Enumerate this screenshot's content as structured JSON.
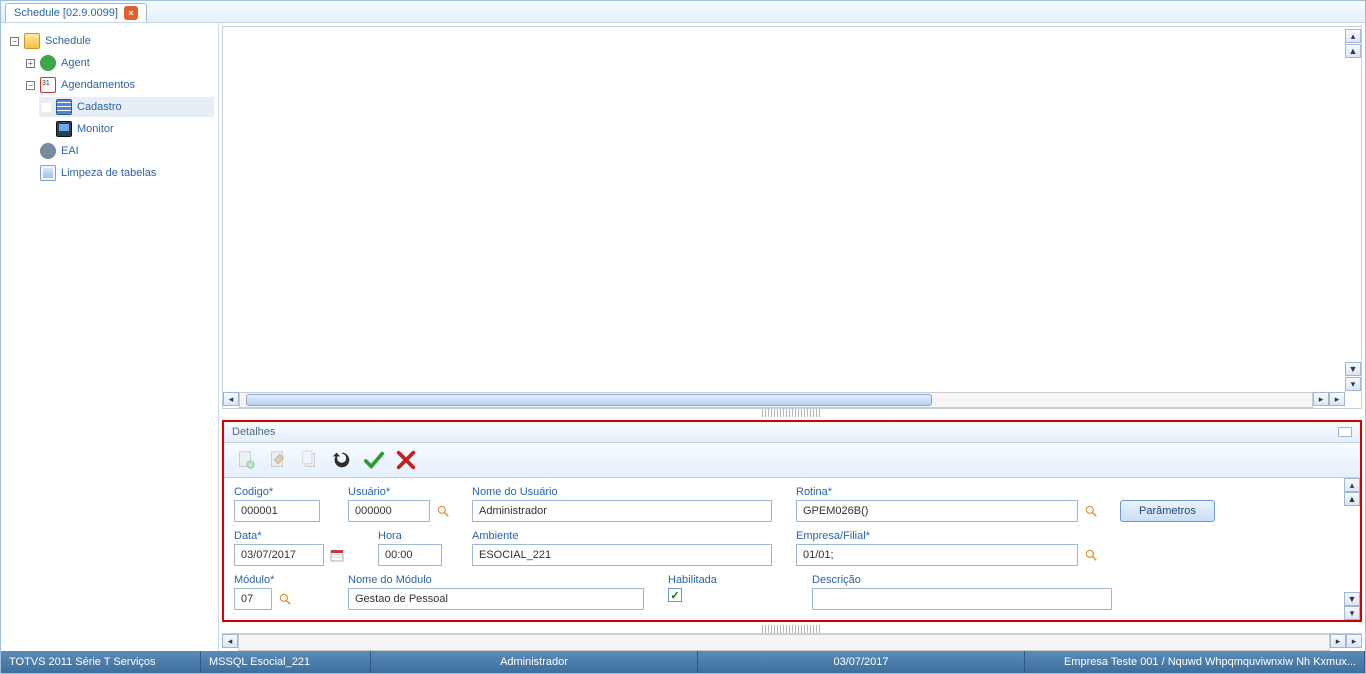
{
  "tab_title": "Schedule [02.9.0099]",
  "tree": {
    "root": "Schedule",
    "agent": "Agent",
    "agendamentos": "Agendamentos",
    "cadastro": "Cadastro",
    "monitor": "Monitor",
    "eai": "EAI",
    "limpeza": "Limpeza de tabelas"
  },
  "details": {
    "title": "Detalhes",
    "labels": {
      "codigo": "Codigo*",
      "usuario": "Usuário*",
      "nome_usuario": "Nome do Usuário",
      "rotina": "Rotina*",
      "parametros_btn": "Parâmetros",
      "data": "Data*",
      "hora": "Hora",
      "ambiente": "Ambiente",
      "empresa_filial": "Empresa/Filial*",
      "modulo": "Módulo*",
      "nome_modulo": "Nome do Módulo",
      "habilitada": "Habilitada",
      "descricao": "Descrição"
    },
    "values": {
      "codigo": "000001",
      "usuario": "000000",
      "nome_usuario": "Administrador",
      "rotina": "GPEM026B()",
      "data": "03/07/2017",
      "hora": "00:00",
      "ambiente": "ESOCIAL_221",
      "empresa_filial": "01/01;",
      "modulo": "07",
      "nome_modulo": "Gestao de Pessoal",
      "habilitada_checked": "✓",
      "descricao": ""
    }
  },
  "status": {
    "product": "TOTVS 2011 Série T Serviços",
    "db": "MSSQL Esocial_221",
    "user": "Administrador",
    "date": "03/07/2017",
    "company": "Empresa Teste 001 / Nquwd Whpqmquviwnxiw Nh Kxmux..."
  }
}
